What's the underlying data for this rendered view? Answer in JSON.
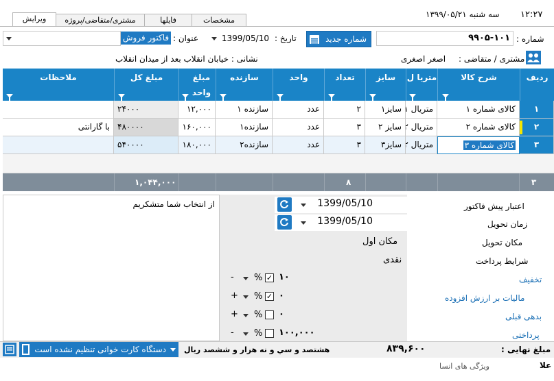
{
  "header": {
    "time": "۱۲:۲۷",
    "date_text": "سه شنبه ۱۳۹۹/۰۵/۲۱",
    "tabs": [
      "ویرایش",
      "مشتری/متقاضی/پروژه",
      "فایلها",
      "مشخصات"
    ]
  },
  "form": {
    "number_label": "شماره :",
    "number_value": "۹۹۰۵-۱۰۱",
    "new_number_button": "شماره جدید",
    "date_label": "تاریخ :",
    "date_value": "1399/05/10",
    "title_label": "عنوان :",
    "title_value": "فاکتور فروش",
    "customer_label": "مشتری / متقاضی :",
    "customer_value": "اصغر اصغری",
    "address_text": "نشانی : خیابان انقلاب بعد از میدان انقلاب"
  },
  "grid": {
    "columns": [
      "ردیف",
      "شرح کالا",
      "متریا ل",
      "سایز",
      "تعداد",
      "واحد",
      "سازنده",
      "مبلغ واحد",
      "مبلغ کل",
      "ملاحظات"
    ],
    "rows": [
      {
        "num": "۱",
        "desc": "کالای شماره ۱",
        "material": "متریال ۱",
        "size": "سایز۱",
        "qty": "۲",
        "unit": "عدد",
        "maker": "سازنده ۱",
        "unit_price": "۱۲,۰۰۰",
        "total": "۲۴۰۰۰",
        "notes": ""
      },
      {
        "num": "۲",
        "desc": "کالای شماره ۲",
        "material": "متریال ۲",
        "size": "سایز ۲",
        "qty": "۳",
        "unit": "عدد",
        "maker": "سازنده۱",
        "unit_price": "۱۶۰,۰۰۰",
        "total": "۴۸۰۰۰۰",
        "notes": "با گارانتی"
      },
      {
        "num": "۳",
        "desc": "کالای شماره ۳",
        "material": "متریال ۲",
        "size": "سایز۳",
        "qty": "۳",
        "unit": "عدد",
        "maker": "سازنده۲",
        "unit_price": "۱۸۰,۰۰۰",
        "total": "۵۴۰۰۰۰",
        "notes": ""
      }
    ],
    "footer_count": "۳",
    "footer_qty": "۸",
    "footer_total": "۱,۰۴۴,۰۰۰"
  },
  "details": {
    "validity_label": "اعتبار پیش فاکتور",
    "validity_value": "1399/05/10",
    "delivery_time_label": "زمان تحویل",
    "delivery_time_value": "1399/05/10",
    "delivery_place_label": "مکان تحویل",
    "delivery_place_value": "مکان اول",
    "payment_terms_label": "شرایط پرداخت",
    "payment_terms_value": "نقدی",
    "discount_label": "تخفیف",
    "discount_value": "۱۰",
    "vat_label": "مالیات بر ارزش افزوده",
    "vat_value": "۰",
    "prior_debt_label": "بدهی قبلی",
    "prior_debt_value": "۰",
    "payment_label": "پرداختی",
    "payment_value": "۱۰۰,۰۰۰",
    "percent_sign": "%",
    "notes_text": "از انتخاب شما متشکریم"
  },
  "footer": {
    "final_label": "مبلغ نهایی :",
    "final_value": "۸۳۹,۶۰۰",
    "final_words": "هشتصد و سي و نه هزار و ششصد ريال",
    "card_reader_text": "دستگاه کارت خوانی تنظیم نشده است",
    "bottom_cut_text": "ویژگی های انسا",
    "bottom_cut_left": "علا"
  }
}
